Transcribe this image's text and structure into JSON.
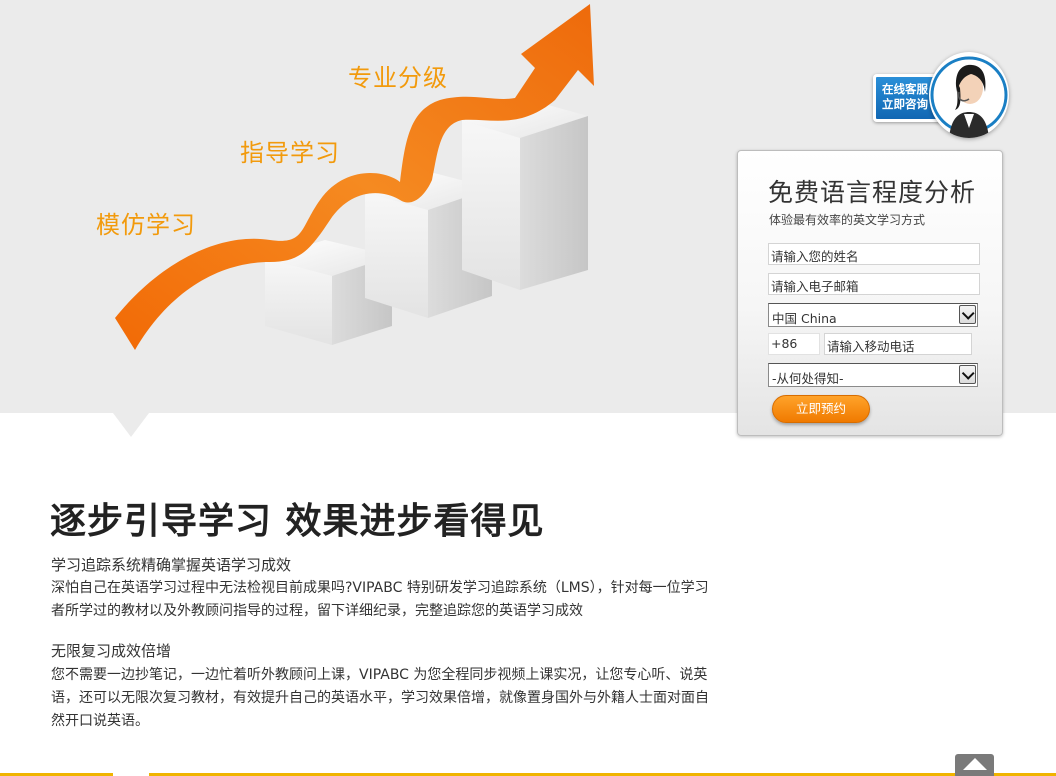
{
  "hero": {
    "steps": [
      "模仿学习",
      "指导学习",
      "专业分级"
    ],
    "colors": {
      "background": "#ebebeb",
      "accent": "#f29a0c",
      "arrow": "#ef7a12"
    }
  },
  "service": {
    "line1": "在线客服",
    "line2": "立即咨询",
    "icon": "customer-service-agent-icon"
  },
  "form": {
    "title": "免费语言程度分析",
    "subtitle": "体验最有效率的英文学习方式",
    "name_placeholder": "请输入您的姓名",
    "email_placeholder": "请输入电子邮箱",
    "country_selected": "中国 China",
    "country_code": "+86",
    "phone_placeholder": "请输入移动电话",
    "source_selected": "-从何处得知-",
    "submit_label": "立即预约",
    "colors": {
      "button": "#f08a00"
    }
  },
  "article": {
    "heading": "逐步引导学习 效果进步看得见",
    "sections": [
      {
        "title": "学习追踪系统精确掌握英语学习成效",
        "body": "深怕自己在英语学习过程中无法检视目前成果吗?VIPABC 特别研发学习追踪系统（LMS），针对每一位学习者所学过的教材以及外教顾问指导的过程，留下详细纪录，完整追踪您的英语学习成效"
      },
      {
        "title": "无限复习成效倍增",
        "body": "您不需要一边抄笔记，一边忙着听外教顾问上课，VIPABC 为您全程同步视频上课实况，让您专心听、说英语，还可以无限次复习教材，有效提升自己的英语水平，学习效果倍增，就像置身国外与外籍人士面对面自然开口说英语。"
      }
    ]
  },
  "footer": {
    "top_icon": "arrow-up-icon",
    "line_color": "#f0b400"
  }
}
